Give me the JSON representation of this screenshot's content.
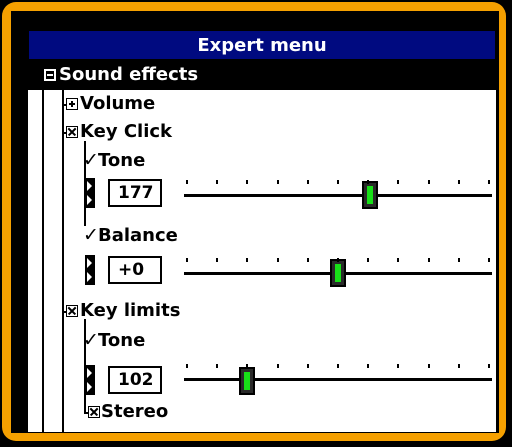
{
  "header": {
    "title": "Expert menu"
  },
  "tree": {
    "sound_effects": {
      "label": "Sound effects",
      "expander": "minus-box-icon"
    },
    "volume": {
      "label": "Volume",
      "expander": "plus-box-icon"
    },
    "key_click": {
      "label": "Key Click",
      "checkbox": "checked-box-icon"
    },
    "tone1": {
      "label": "Tone",
      "check": "✓"
    },
    "tone1_value": "177",
    "tone1_slider_fraction": 0.61,
    "balance": {
      "label": "Balance",
      "check": "✓"
    },
    "balance_value": "+0",
    "balance_slider_fraction": 0.5,
    "key_limits": {
      "label": "Key limits",
      "checkbox": "checked-box-icon"
    },
    "tone2": {
      "label": "Tone",
      "check": "✓"
    },
    "tone2_value": "102",
    "tone2_slider_fraction": 0.19,
    "stereo": {
      "label": "Stereo",
      "checkbox": "checked-box-icon"
    }
  },
  "colors": {
    "frame": "#f5a000",
    "title_bar": "#000a80",
    "slider_thumb": "#18e018"
  }
}
